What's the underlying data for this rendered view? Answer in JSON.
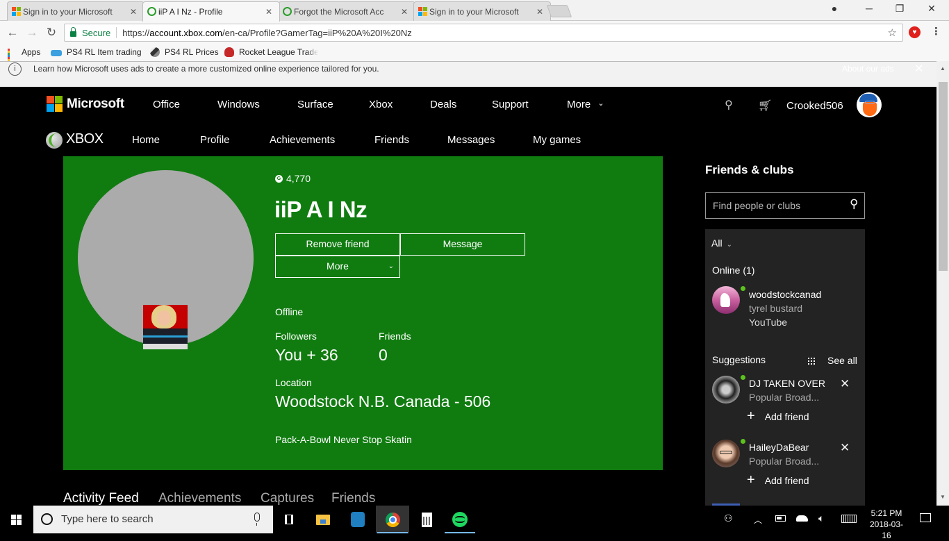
{
  "browser": {
    "tabs": [
      {
        "title": "Sign in to your Microsoft",
        "icon": "microsoft-icon",
        "active": false
      },
      {
        "title": "iiP A I Nz - Profile",
        "icon": "xbox-icon",
        "active": true
      },
      {
        "title": "Forgot the Microsoft Acc",
        "icon": "xbox-icon",
        "active": false
      },
      {
        "title": "Sign in to your Microsoft",
        "icon": "microsoft-icon",
        "active": false
      }
    ],
    "close_glyph": "✕",
    "secure_label": "Secure",
    "url_scheme": "https://",
    "url_host": "account.xbox.com",
    "url_path": "/en-ca/Profile?GamerTag=iiP%20A%20I%20Nz",
    "bookmarks": [
      {
        "label": "Apps",
        "icon": "apps-grid-icon"
      },
      {
        "label": "PS4 RL Item trading",
        "icon": "bookmark-favicon-icon"
      },
      {
        "label": "PS4 RL Prices",
        "icon": "bookmark-favicon-icon"
      },
      {
        "label": "Rocket League Trades",
        "icon": "bookmark-favicon-icon"
      }
    ]
  },
  "adbar": {
    "info": "i",
    "message": "Learn how Microsoft uses ads to create a more customized online experience tailored for you.",
    "about": "About our ads",
    "close": "✕"
  },
  "ms_header": {
    "brand": "Microsoft",
    "nav": [
      "Office",
      "Windows",
      "Surface",
      "Xbox",
      "Deals",
      "Support",
      "More"
    ],
    "more_chevron": "⌄",
    "username": "Crooked506"
  },
  "xbox_header": {
    "brand": "XBOX",
    "nav": [
      "Home",
      "Profile",
      "Achievements",
      "Friends",
      "Messages",
      "My games"
    ]
  },
  "profile": {
    "gamerscore_icon": "G",
    "gamerscore": "4,770",
    "gamertag": "iiP A I Nz",
    "buttons": {
      "remove_friend": "Remove friend",
      "message": "Message",
      "more": "More"
    },
    "status": "Offline",
    "followers_label": "Followers",
    "followers_value": "You + 36",
    "friends_label": "Friends",
    "friends_value": "0",
    "location_label": "Location",
    "location_value": "Woodstock N.B. Canada - 506",
    "bio": "Pack-A-Bowl Never Stop Skatin",
    "tabs": [
      "Activity Feed",
      "Achievements",
      "Captures",
      "Friends"
    ],
    "active_tab": "Activity Feed"
  },
  "friends_clubs": {
    "title": "Friends & clubs",
    "search_placeholder": "Find people or clubs",
    "filter": "All",
    "online_label": "Online (1)",
    "online": [
      {
        "name": "woodstockcanad",
        "real_name": "tyrel bustard",
        "activity": "YouTube",
        "status": "online"
      }
    ],
    "suggestions_label": "Suggestions",
    "see_all": "See all",
    "suggestions": [
      {
        "name": "DJ TAKEN OVER",
        "reason": "Popular Broad...",
        "add_label": "Add friend",
        "status": "online"
      },
      {
        "name": "HaileyDaBear",
        "reason": "Popular Broad...",
        "add_label": "Add friend",
        "status": "online"
      }
    ]
  },
  "taskbar": {
    "search_placeholder": "Type here to search",
    "apps": [
      "task-view",
      "file-explorer",
      "touch-app",
      "chrome",
      "calculator",
      "spotify"
    ],
    "time": "5:21 PM",
    "date": "2018-03-16"
  },
  "colors": {
    "profile_green": "#107c10",
    "online_dot": "#5dc21e",
    "panel_bg": "#232323"
  }
}
